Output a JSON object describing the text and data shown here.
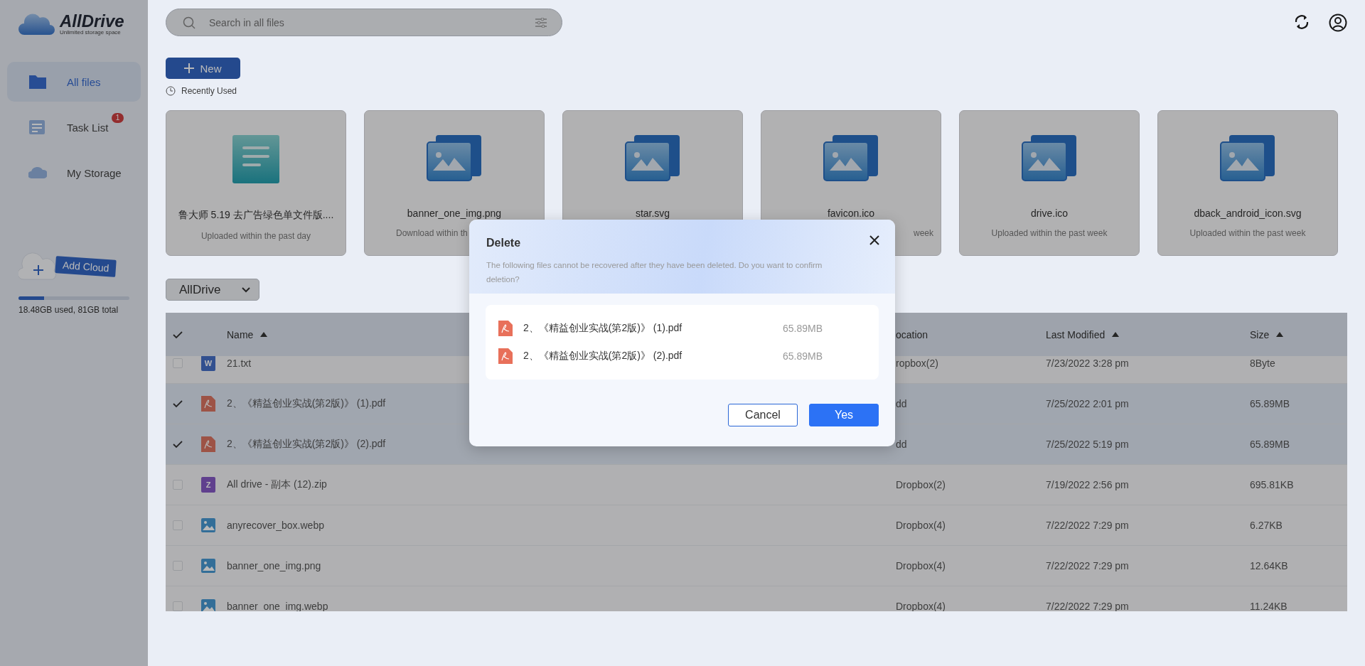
{
  "app": {
    "title": "AllDrive",
    "subtitle": "Unlimited storage space"
  },
  "sidebar": {
    "items": [
      {
        "label": "All files",
        "kind": "folder",
        "selected": true
      },
      {
        "label": "Task List",
        "kind": "tasks",
        "selected": false,
        "badge": "1"
      },
      {
        "label": "My Storage",
        "kind": "cloud",
        "selected": false
      }
    ],
    "add_cloud": {
      "label": "Add Cloud"
    },
    "storage": {
      "level": 0.228,
      "text": "18.48GB used, 81GB total"
    }
  },
  "search": {
    "placeholder": "Search in all files"
  },
  "new_button": {
    "label": "New"
  },
  "recent": {
    "title": "Recently Used",
    "items": [
      {
        "kind": "doc",
        "name": "鲁大师 5.19 去广告绿色单文件版....",
        "note": "Uploaded within the past day"
      },
      {
        "kind": "image",
        "name": "banner_one_img.png",
        "note": "Download within th"
      },
      {
        "kind": "image",
        "name": "star.svg"
      },
      {
        "kind": "image",
        "name": "favicon.ico",
        "note": "week"
      },
      {
        "kind": "image",
        "name": "drive.ico",
        "note": "Uploaded within the past week"
      },
      {
        "kind": "image",
        "name": "dback_android_icon.svg",
        "note": "Uploaded within the past week"
      }
    ]
  },
  "filter": {
    "value": "AllDrive"
  },
  "table": {
    "check_all": true,
    "columns": [
      {
        "label": "Name",
        "sorted_ascending": true
      },
      {
        "label": "ocation",
        "sorted_ascending": false
      },
      {
        "label": "Last Modified",
        "sorted_ascending": true
      },
      {
        "label": "Size",
        "sorted_ascending": true
      }
    ],
    "rows": [
      {
        "kind": "word",
        "icon_text": "W",
        "checked": false,
        "name": "21.txt",
        "location": "ropbox(2)",
        "modified": "7/23/2022 3:28 pm",
        "size": "8Byte"
      },
      {
        "kind": "pdf",
        "checked": true,
        "name": "2、《精益创业实战(第2版)》 (1).pdf",
        "location": "dd",
        "modified": "7/25/2022 2:01 pm",
        "size": "65.89MB"
      },
      {
        "kind": "pdf",
        "checked": true,
        "name": "2、《精益创业实战(第2版)》 (2).pdf",
        "location": "dd",
        "modified": "7/25/2022 5:19 pm",
        "size": "65.89MB"
      },
      {
        "kind": "zip",
        "icon_text": "Z",
        "checked": false,
        "name": "All drive - 副本 (12).zip",
        "location": "Dropbox(2)",
        "modified": "7/19/2022 2:56 pm",
        "size": "695.81KB"
      },
      {
        "kind": "image",
        "checked": false,
        "name": "anyrecover_box.webp",
        "location": "Dropbox(4)",
        "modified": "7/22/2022 7:29 pm",
        "size": "6.27KB"
      },
      {
        "kind": "image",
        "checked": false,
        "name": "banner_one_img.png",
        "location": "Dropbox(4)",
        "modified": "7/22/2022 7:29 pm",
        "size": "12.64KB"
      },
      {
        "kind": "image",
        "checked": false,
        "name": "banner_one_img.webp",
        "location": "Dropbox(4)",
        "modified": "7/22/2022 7:29 pm",
        "size": "11.24KB"
      }
    ]
  },
  "dialog": {
    "title": "Delete",
    "message": "The following files cannot be recovered after they have been deleted. Do you want to confirm deletion?",
    "files": [
      {
        "kind": "pdf",
        "name": "2、《精益创业实战(第2版)》 (1).pdf",
        "size": "65.89MB"
      },
      {
        "kind": "pdf",
        "name": "2、《精益创业实战(第2版)》 (2).pdf",
        "size": "65.89MB"
      }
    ],
    "buttons": [
      {
        "label": "Cancel",
        "kind": "secondary"
      },
      {
        "label": "Yes",
        "kind": "primary"
      }
    ]
  }
}
